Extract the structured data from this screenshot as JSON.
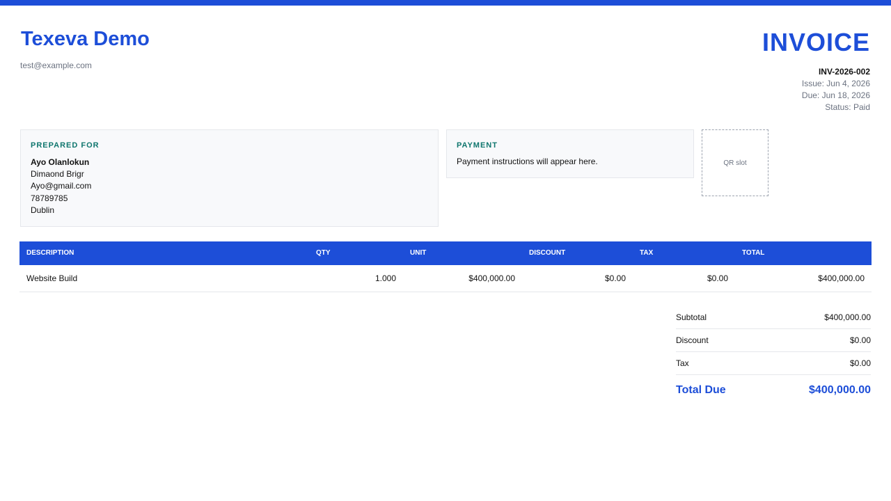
{
  "company": {
    "name": "Texeva Demo",
    "email": "test@example.com"
  },
  "invoice": {
    "title": "INVOICE",
    "number": "INV-2026-002",
    "issue": "Issue: Jun 4, 2026",
    "due": "Due: Jun 18, 2026",
    "status": "Status: Paid"
  },
  "prepared_for": {
    "heading": "PREPARED FOR",
    "name": "Ayo Olanlokun",
    "company": "Dimaond Brigr",
    "email": "Ayo@gmail.com",
    "phone": "78789785",
    "city": "Dublin"
  },
  "payment": {
    "heading": "PAYMENT",
    "text": "Payment instructions will appear here."
  },
  "qr": {
    "label": "QR slot"
  },
  "table": {
    "headers": [
      "DESCRIPTION",
      "QTY",
      "UNIT",
      "DISCOUNT",
      "TAX",
      "TOTAL"
    ],
    "rows": [
      {
        "description": "Website Build",
        "qty": "1.000",
        "unit": "$400,000.00",
        "discount": "$0.00",
        "tax": "$0.00",
        "total": "$400,000.00"
      }
    ]
  },
  "totals": {
    "subtotal_label": "Subtotal",
    "subtotal": "$400,000.00",
    "discount_label": "Discount",
    "discount": "$0.00",
    "tax_label": "Tax",
    "tax": "$0.00",
    "due_label": "Total Due",
    "due": "$400,000.00"
  },
  "colors": {
    "accent": "#1d4ed8",
    "heading_teal": "#0f766e",
    "card_bg": "#f8f9fb"
  }
}
